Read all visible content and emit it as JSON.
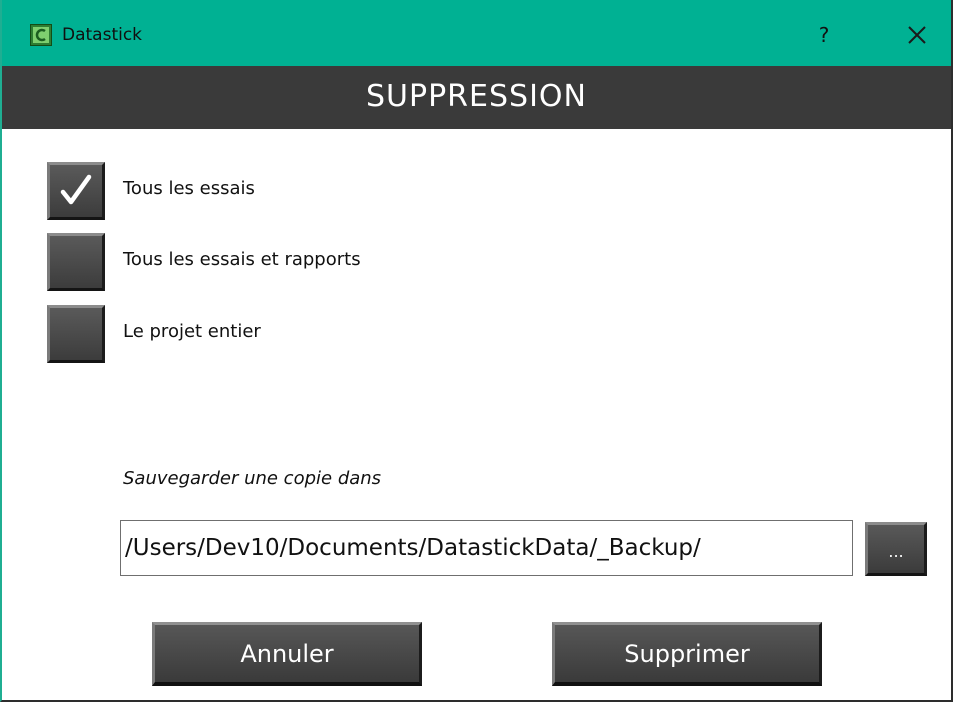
{
  "window": {
    "title": "Datastick",
    "help_label": "?",
    "icons": {
      "app": "datastick-logo-icon",
      "close": "close-icon"
    }
  },
  "header": {
    "title": "SUPPRESSION"
  },
  "options": [
    {
      "label": "Tous les essais",
      "checked": true
    },
    {
      "label": "Tous les essais et rapports",
      "checked": false
    },
    {
      "label": "Le projet entier",
      "checked": false
    }
  ],
  "backup": {
    "label": "Sauvegarder une copie dans",
    "path": "/Users/Dev10/Documents/DatastickData/_Backup/",
    "browse_label": "..."
  },
  "actions": {
    "cancel_label": "Annuler",
    "delete_label": "Supprimer"
  },
  "colors": {
    "titlebar": "#00b193",
    "header_band": "#3a3a3a",
    "button": "#4a4a4a"
  }
}
